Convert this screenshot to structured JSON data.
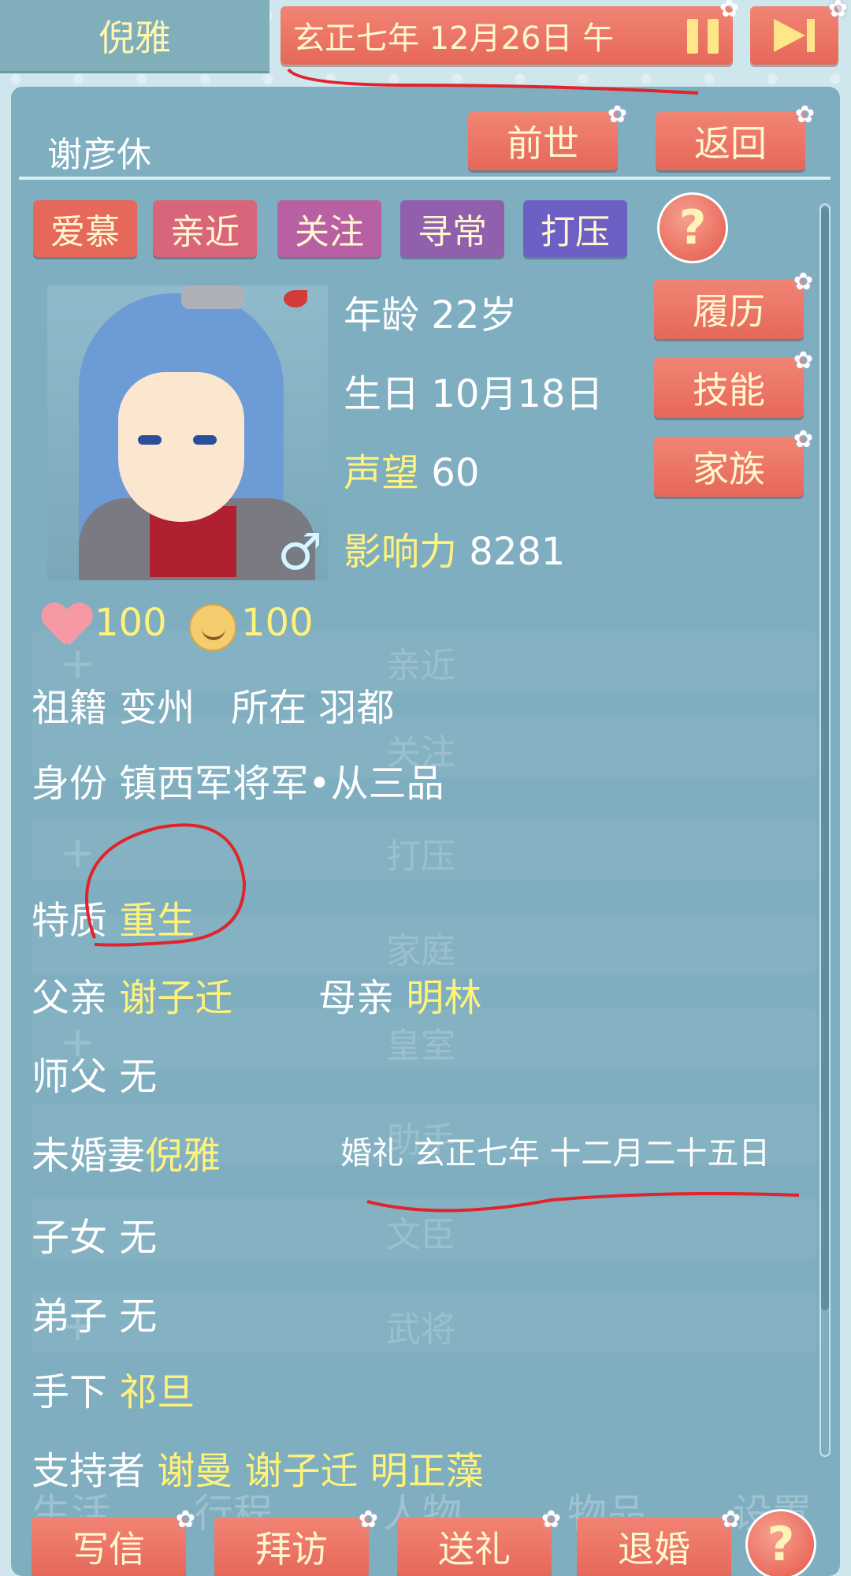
{
  "header": {
    "player_name": "倪雅",
    "date_text": "玄正七年 12月26日 午",
    "pause_icon": "pause-icon",
    "next_icon": "skip-next-icon"
  },
  "panel": {
    "character_name": "谢彦休",
    "top_buttons": {
      "past_life": "前世",
      "back": "返回"
    },
    "tags": [
      "爱慕",
      "亲近",
      "关注",
      "寻常",
      "打压"
    ],
    "help": "?"
  },
  "stats": {
    "age_label": "年龄",
    "age_value": "22岁",
    "birthday_label": "生日",
    "birthday_value": "10月18日",
    "prestige_label": "声望",
    "prestige_value": "60",
    "influence_label": "影响力",
    "influence_value": "8281",
    "gender_symbol": "♂"
  },
  "side_buttons": {
    "resume": "履历",
    "skills": "技能",
    "family": "家族"
  },
  "meters": {
    "affection": "100",
    "mood": "100"
  },
  "info": {
    "origin_label": "祖籍",
    "origin_value": "变州",
    "location_label": "所在",
    "location_value": "羽都",
    "identity_label": "身份",
    "identity_value": "镇西军将军•从三品",
    "trait_label": "特质",
    "trait_value": "重生",
    "father_label": "父亲",
    "father_value": "谢子迁",
    "mother_label": "母亲",
    "mother_value": "明林",
    "master_label": "师父",
    "master_value": "无",
    "fiance_label": "未婚妻",
    "fiance_value": "倪雅",
    "wedding_text": "婚礼 玄正七年 十二月二十五日",
    "children_label": "子女",
    "children_value": "无",
    "disciples_label": "弟子",
    "disciples_value": "无",
    "subordinates_label": "手下",
    "subordinates_value": "祁旦",
    "supporters_label": "支持者",
    "supporters_value": "谢曼 谢子迁 明正藻"
  },
  "background_rows": [
    "亲近",
    "关注",
    "打压",
    "家庭",
    "皇室",
    "助手",
    "文臣",
    "武将"
  ],
  "bottom_nav_background": [
    "生活",
    "行程",
    "人物",
    "物品",
    "设置"
  ],
  "bottom_buttons": {
    "write": "写信",
    "visit": "拜访",
    "gift": "送礼",
    "break_engagement": "退婚",
    "help": "?"
  },
  "colors": {
    "accent_button": "#e96c5d",
    "highlight_text": "#fff27a",
    "annotation": "#e0242c"
  }
}
